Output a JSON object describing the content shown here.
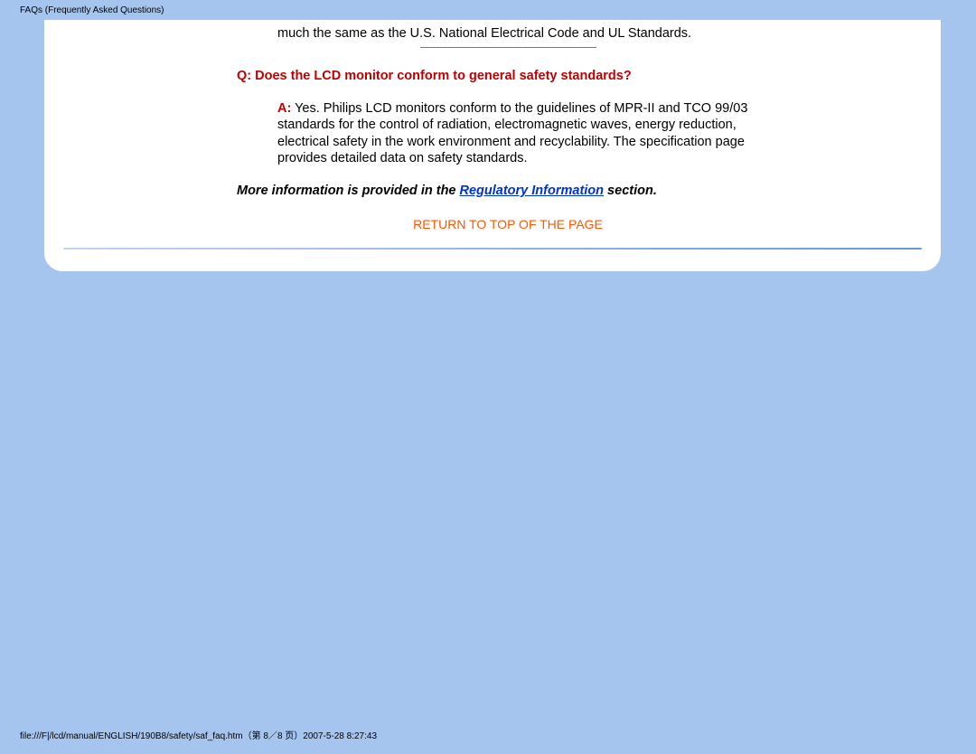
{
  "header": "FAQs (Frequently Asked Questions)",
  "intro_continuation": "much the same as the U.S. National Electrical Code and UL Standards.",
  "question_label": "Q:",
  "question_text": "Does the LCD monitor conform to general safety standards?",
  "answer_label": "A:",
  "answer_text": " Yes. Philips LCD monitors conform to the guidelines of MPR-II and TCO 99/03 standards for the control of radiation, electromagnetic waves, energy reduction, electrical safety in the work environment and recyclability. The specification page provides detailed data on safety standards.",
  "more_info_pre": "More information is provided in the ",
  "reg_link": "Regulatory Information",
  "more_info_post": " section.",
  "return_top": "RETURN TO TOP OF THE PAGE",
  "footer": "file:///F|/lcd/manual/ENGLISH/190B8/safety/saf_faq.htm（第 8／8 页）2007-5-28 8:27:43"
}
